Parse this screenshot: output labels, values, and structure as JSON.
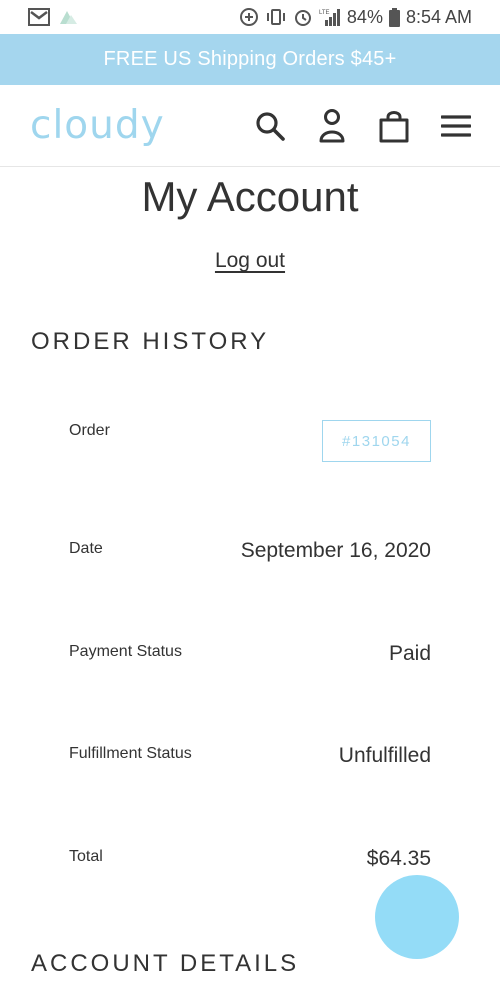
{
  "status_bar": {
    "battery": "84%",
    "time": "8:54 AM",
    "network": "LTE"
  },
  "promo": {
    "text": "FREE US Shipping Orders $45+"
  },
  "header": {
    "logo": "cloudy",
    "icons": [
      "search-icon",
      "account-icon",
      "cart-icon",
      "menu-icon"
    ]
  },
  "page": {
    "title": "My Account",
    "logout_label": "Log out"
  },
  "order_history": {
    "heading": "ORDER HISTORY",
    "rows": [
      {
        "label": "Order",
        "value": "#131054"
      },
      {
        "label": "Date",
        "value": "September 16, 2020"
      },
      {
        "label": "Payment Status",
        "value": "Paid"
      },
      {
        "label": "Fulfillment Status",
        "value": "Unfulfilled"
      },
      {
        "label": "Total",
        "value": "$64.35"
      }
    ]
  },
  "account_details": {
    "heading": "ACCOUNT DETAILS"
  },
  "colors": {
    "brand": "#9fd6ee",
    "promo_bg": "#a5d6ee",
    "fab": "#94dcf7",
    "text": "#333333"
  }
}
